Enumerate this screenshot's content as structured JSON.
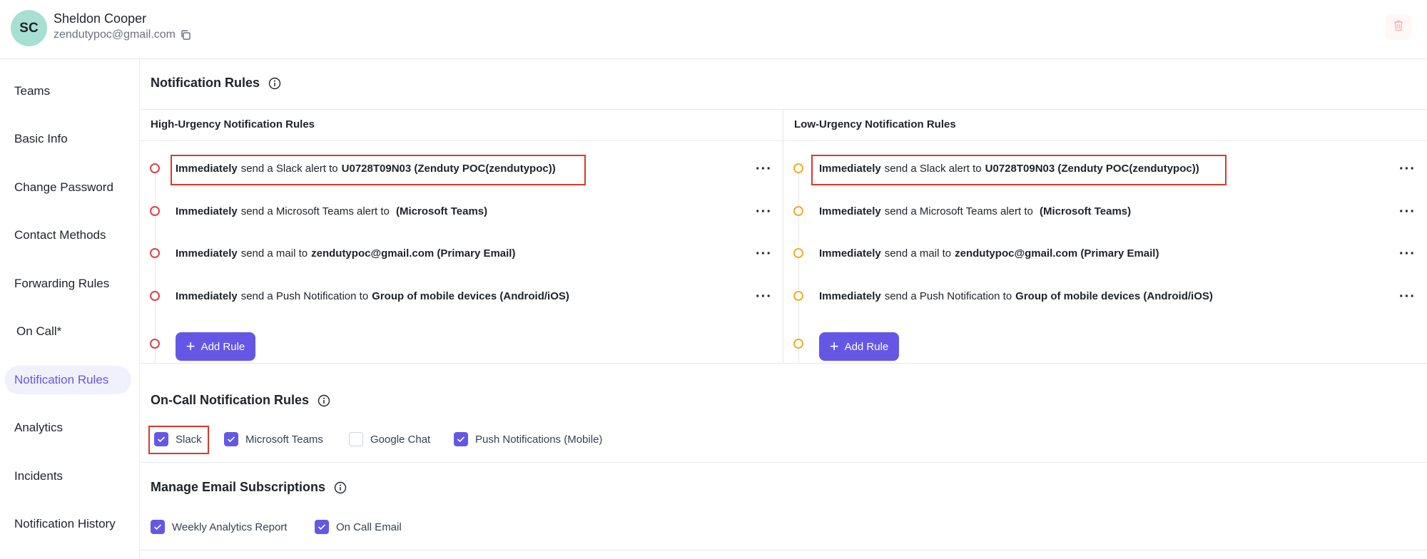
{
  "header": {
    "avatar_initials": "SC",
    "user_name": "Sheldon Cooper",
    "user_email": "zendutypoc@gmail.com",
    "copy_icon": "copy-icon",
    "delete_icon": "trash-icon"
  },
  "sidebar": {
    "items": [
      {
        "label": "Teams",
        "active": false
      },
      {
        "label": "Basic Info",
        "active": false
      },
      {
        "label": "Change Password",
        "active": false
      },
      {
        "label": "Contact Methods",
        "active": false
      },
      {
        "label": "Forwarding Rules",
        "active": false
      },
      {
        "label": "On Call*",
        "active": false
      },
      {
        "label": "Notification Rules",
        "active": true
      },
      {
        "label": "Analytics",
        "active": false
      },
      {
        "label": "Incidents",
        "active": false
      },
      {
        "label": "Notification History",
        "active": false
      }
    ]
  },
  "notification_rules": {
    "title": "Notification Rules",
    "high": {
      "heading": "High-Urgency Notification Rules",
      "rules": [
        {
          "when": "Immediately",
          "action": "send a Slack alert to",
          "target": "U0728T09N03 (Zenduty POC(zendutypoc))"
        },
        {
          "when": "Immediately",
          "action": "send a Microsoft Teams alert to",
          "target": " (Microsoft Teams)"
        },
        {
          "when": "Immediately",
          "action": "send a mail to",
          "target": "zendutypoc@gmail.com (Primary Email)"
        },
        {
          "when": "Immediately",
          "action": "send a Push Notification to",
          "target": "Group of mobile devices (Android/iOS)"
        }
      ],
      "add_label": "Add Rule"
    },
    "low": {
      "heading": "Low-Urgency Notification Rules",
      "rules": [
        {
          "when": "Immediately",
          "action": "send a Slack alert to",
          "target": "U0728T09N03 (Zenduty POC(zendutypoc))"
        },
        {
          "when": "Immediately",
          "action": "send a Microsoft Teams alert to",
          "target": " (Microsoft Teams)"
        },
        {
          "when": "Immediately",
          "action": "send a mail to",
          "target": "zendutypoc@gmail.com (Primary Email)"
        },
        {
          "when": "Immediately",
          "action": "send a Push Notification to",
          "target": "Group of mobile devices (Android/iOS)"
        }
      ],
      "add_label": "Add Rule"
    }
  },
  "oncall": {
    "title": "On-Call Notification Rules",
    "options": [
      {
        "label": "Slack",
        "checked": true
      },
      {
        "label": "Microsoft Teams",
        "checked": true
      },
      {
        "label": "Google Chat",
        "checked": false
      },
      {
        "label": "Push Notifications (Mobile)",
        "checked": true
      }
    ]
  },
  "email_subscriptions": {
    "title": "Manage Email Subscriptions",
    "options": [
      {
        "label": "Weekly Analytics Report",
        "checked": true
      },
      {
        "label": "On Call Email",
        "checked": true
      }
    ]
  },
  "colors": {
    "accent": "#6557e6",
    "high_dot": "#d9434b",
    "low_dot": "#f0ad2a",
    "highlight_box": "#d63a2b",
    "avatar_bg": "#a8dfd3"
  }
}
